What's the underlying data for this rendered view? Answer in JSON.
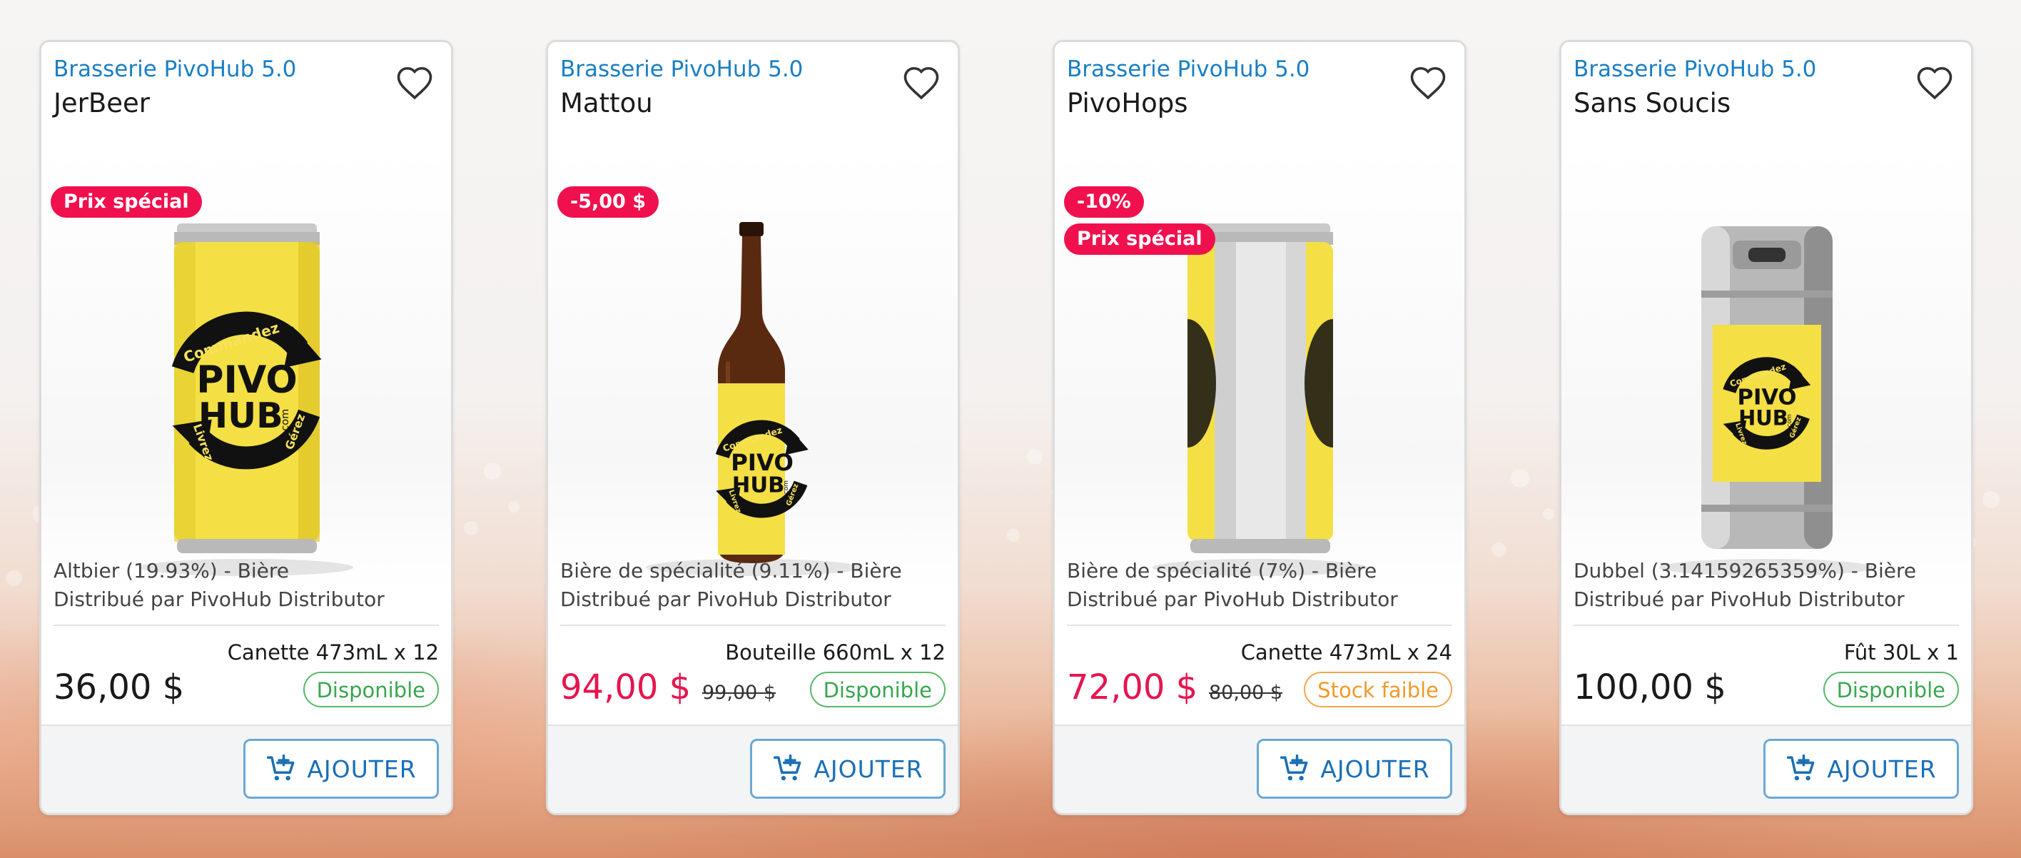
{
  "colors": {
    "brand_link": "#1a7fc4",
    "sale_price": "#e6154f",
    "badge_bg": "#f0104e",
    "available": "#38a64f",
    "low_stock": "#ef9a2a",
    "button_text": "#1a6fb7"
  },
  "products": [
    {
      "brewery": "Brasserie PivoHub 5.0",
      "name": "JerBeer",
      "badges": [
        "Prix spécial"
      ],
      "image": "yellow-can",
      "style_line": "Altbier (19.93%) - Bière",
      "distributor_line": "Distribué par PivoHub Distributor",
      "format": "Canette 473mL x 12",
      "price": "36,00 $",
      "old_price": "",
      "status": "Disponible",
      "status_kind": "available",
      "button_label": "AJOUTER"
    },
    {
      "brewery": "Brasserie PivoHub 5.0",
      "name": "Mattou",
      "badges": [
        "-5,00 $"
      ],
      "image": "brown-bottle",
      "style_line": "Bière de spécialité (9.11%) - Bière",
      "distributor_line": "Distribué par PivoHub Distributor",
      "format": "Bouteille 660mL x 12",
      "price": "94,00 $",
      "old_price": "99,00 $",
      "status": "Disponible",
      "status_kind": "available",
      "button_label": "AJOUTER"
    },
    {
      "brewery": "Brasserie PivoHub 5.0",
      "name": "PivoHops",
      "badges": [
        "-10%",
        "Prix spécial"
      ],
      "image": "silver-can",
      "style_line": "Bière de spécialité (7%) - Bière",
      "distributor_line": "Distribué par PivoHub Distributor",
      "format": "Canette 473mL x 24",
      "price": "72,00 $",
      "old_price": "80,00 $",
      "status": "Stock faible",
      "status_kind": "low",
      "button_label": "AJOUTER"
    },
    {
      "brewery": "Brasserie PivoHub 5.0",
      "name": "Sans Soucis",
      "badges": [],
      "image": "keg",
      "style_line": "Dubbel (3.14159265359%) - Bière",
      "distributor_line": "Distribué par PivoHub Distributor",
      "format": "Fût 30L x 1",
      "price": "100,00 $",
      "old_price": "",
      "status": "Disponible",
      "status_kind": "available",
      "button_label": "AJOUTER"
    }
  ],
  "logo_text": {
    "top": "Commandez",
    "line1": "PIVO",
    "line2": "HUB",
    "domain": ".com",
    "left": "Livrez",
    "right": "Gérez"
  }
}
